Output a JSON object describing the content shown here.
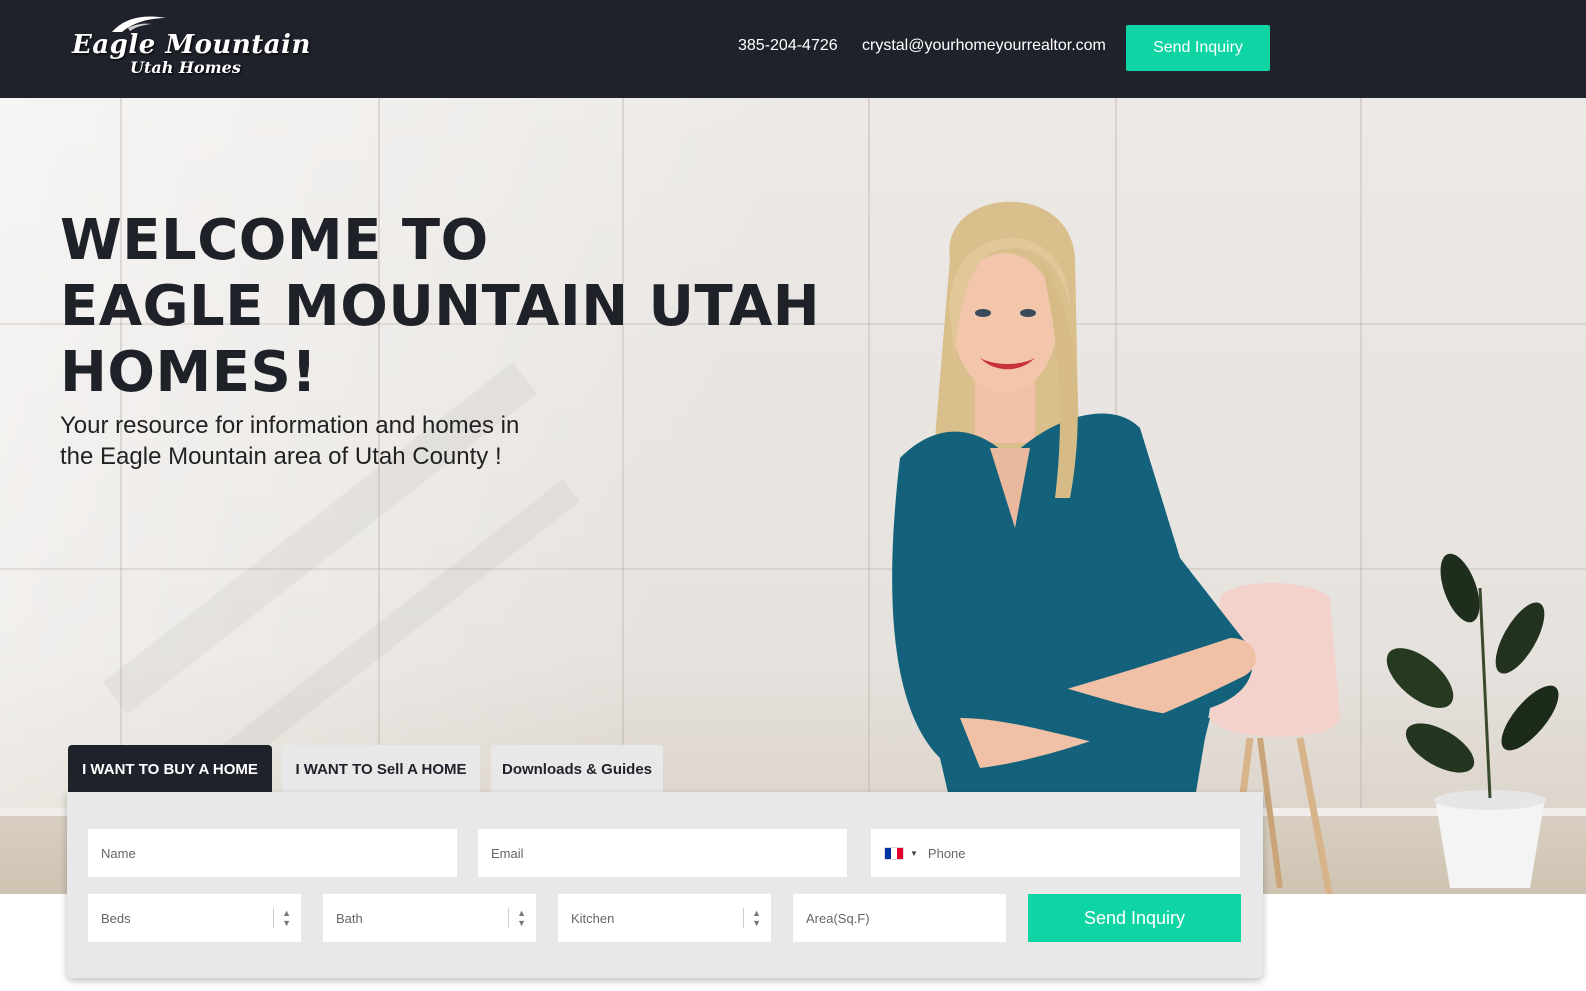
{
  "header": {
    "logo_line1": "Eagle Mountain",
    "logo_line2": "Utah Homes",
    "phone": "385-204-4726",
    "email": "crystal@yourhomeyourrealtor.com",
    "cta_label": "Send Inquiry"
  },
  "hero": {
    "title_line1": "WELCOME TO",
    "title_line2": "EAGLE MOUNTAIN UTAH",
    "title_line3": "HOMES!",
    "subtitle_line1": "Your resource for information and homes in",
    "subtitle_line2": "the Eagle Mountain area of Utah County !"
  },
  "tabs": [
    {
      "label": "I WANT TO BUY A HOME",
      "active": true
    },
    {
      "label": "I WANT TO Sell A HOME",
      "active": false
    },
    {
      "label": "Downloads & Guides",
      "active": false
    }
  ],
  "form": {
    "name_placeholder": "Name",
    "email_placeholder": "Email",
    "phone_placeholder": "Phone",
    "beds_placeholder": "Beds",
    "bath_placeholder": "Bath",
    "kitchen_placeholder": "Kitchen",
    "area_placeholder": "Area(Sq.F)",
    "submit_label": "Send Inquiry",
    "phone_country_flag": "flag-france-icon"
  },
  "colors": {
    "header_bg": "#1f222b",
    "accent": "#0fd4a4",
    "panel_bg": "#e8e8e8"
  }
}
